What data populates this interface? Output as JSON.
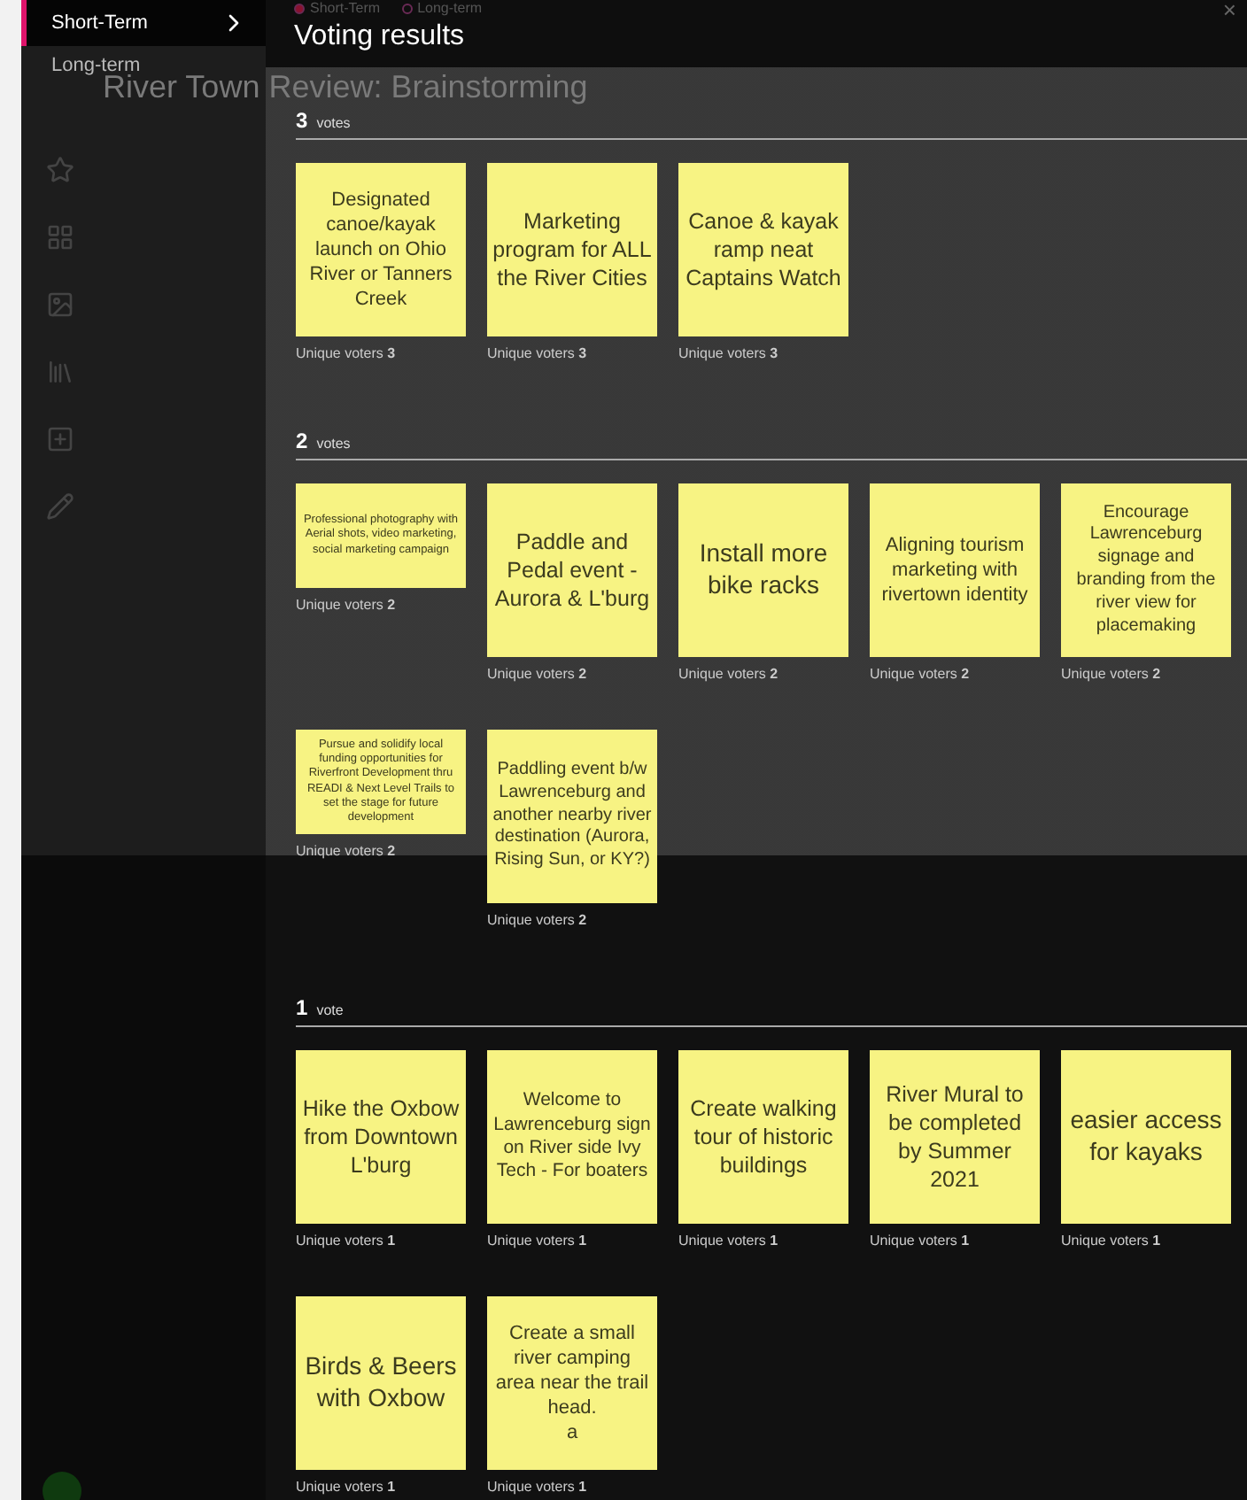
{
  "board": {
    "title": "River Town Review: Brainstorming",
    "tabs": [
      {
        "label": "Short-Term",
        "selected": true
      },
      {
        "label": "Long-term",
        "selected": false
      }
    ],
    "close": "×"
  },
  "sidebar": {
    "items": [
      {
        "label": "Short-Term",
        "selected": true
      },
      {
        "label": "Long-term",
        "selected": false
      }
    ]
  },
  "panel": {
    "title": "Voting results"
  },
  "groups": [
    {
      "count": "3",
      "unit": "votes",
      "stickies": [
        {
          "kind": "note",
          "text": "Designated canoe/kayak launch on Ohio River or Tanners Creek",
          "voters_label": "Unique voters",
          "voters": "3"
        },
        {
          "kind": "note",
          "text": "Marketing program for ALL the River Cities",
          "voters_label": "Unique voters",
          "voters": "3"
        },
        {
          "kind": "note",
          "text": "Canoe & kayak ramp neat Captains Watch",
          "voters_label": "Unique voters",
          "voters": "3"
        }
      ]
    },
    {
      "count": "2",
      "unit": "votes",
      "stickies": [
        {
          "kind": "compact",
          "text": "Professional photography with Aerial shots, video marketing, social marketing campaign",
          "voters_label": "Unique voters",
          "voters": "2"
        },
        {
          "kind": "note",
          "text": "Paddle and Pedal event - Aurora & L'burg",
          "voters_label": "Unique voters",
          "voters": "2"
        },
        {
          "kind": "note",
          "text": "Install more bike racks",
          "voters_label": "Unique voters",
          "voters": "2"
        },
        {
          "kind": "note",
          "text": "Aligning tourism marketing with rivertown identity",
          "voters_label": "Unique voters",
          "voters": "2"
        },
        {
          "kind": "note",
          "text": "Encourage Lawrenceburg signage and branding from the river view for placemaking",
          "voters_label": "Unique voters",
          "voters": "2"
        },
        {
          "kind": "compact",
          "text": "Pursue and solidify local funding opportunities for Riverfront Development thru READI & Next Level Trails to set the stage for future development",
          "voters_label": "Unique voters",
          "voters": "2"
        },
        {
          "kind": "note",
          "text": "Paddling event b/w Lawrenceburg and another nearby river destination (Aurora, Rising Sun, or KY?)",
          "voters_label": "Unique voters",
          "voters": "2"
        }
      ]
    },
    {
      "count": "1",
      "unit": "vote",
      "stickies": [
        {
          "kind": "note",
          "text": "Hike the Oxbow from Downtown L'burg",
          "voters_label": "Unique voters",
          "voters": "1"
        },
        {
          "kind": "note",
          "text": "Welcome to Lawrenceburg sign on River side Ivy Tech - For boaters",
          "voters_label": "Unique voters",
          "voters": "1"
        },
        {
          "kind": "note",
          "text": "Create walking tour of historic buildings",
          "voters_label": "Unique voters",
          "voters": "1"
        },
        {
          "kind": "note",
          "text": "River Mural to be completed by Summer 2021",
          "voters_label": "Unique voters",
          "voters": "1"
        },
        {
          "kind": "note",
          "text": "easier access for kayaks",
          "voters_label": "Unique voters",
          "voters": "1"
        },
        {
          "kind": "note",
          "text": "Birds & Beers with Oxbow",
          "voters_label": "Unique voters",
          "voters": "1"
        },
        {
          "kind": "note",
          "text": "Create a small river camping area near the trail head.\na",
          "voters_label": "Unique voters",
          "voters": "1"
        }
      ]
    }
  ]
}
